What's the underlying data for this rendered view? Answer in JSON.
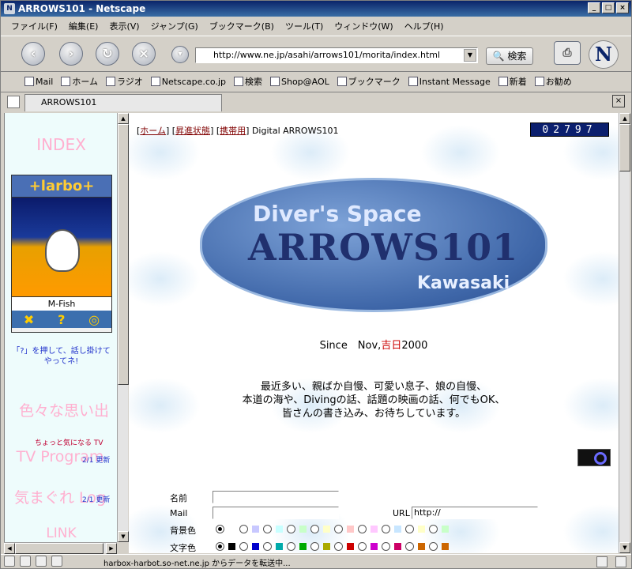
{
  "window": {
    "title": "ARROWS101 - Netscape",
    "minimize": "_",
    "maximize": "□",
    "close": "×"
  },
  "menu": [
    "ファイル(F)",
    "編集(E)",
    "表示(V)",
    "ジャンプ(G)",
    "ブックマーク(B)",
    "ツール(T)",
    "ウィンドウ(W)",
    "ヘルプ(H)"
  ],
  "nav": {
    "back": "‹",
    "forward": "›",
    "reload": "↻",
    "stop": "×",
    "url": "http://www.ne.jp/asahi/arrows101/morita/index.html",
    "search_label": "検索",
    "logo_letter": "N"
  },
  "bookmarks": [
    "Mail",
    "ホーム",
    "ラジオ",
    "Netscape.co.jp",
    "検索",
    "Shop@AOL",
    "ブックマーク",
    "Instant Message",
    "新着",
    "お勧め"
  ],
  "tab": {
    "label": "ARROWS101",
    "close": "×"
  },
  "left": {
    "index_title": "INDEX",
    "harbot_brand": "+larbo+",
    "harbot_name": "M-Fish",
    "harbot_icons": [
      "✖",
      "?",
      "◎"
    ],
    "hint": "「?」を押して、話し掛けて やってネ!",
    "item1": "色々な思い出",
    "item2_small": "ちょっと気になる TV",
    "item2_big": "TV Program",
    "item2_update": "2/1 更新",
    "item3_big": "気まぐれ Log",
    "item3_update": "2/1 更新",
    "link": "LINK"
  },
  "main": {
    "links": [
      "ホーム",
      "昇進状態",
      "携帯用"
    ],
    "site_label": "Digital ARROWS101",
    "counter": "02797",
    "logo": {
      "line1": "Diver's Space",
      "line2": "ARROWS101",
      "line3": "Kawasaki"
    },
    "since_prefix": "Since　Nov,",
    "since_red": "吉日",
    "since_year": "2000",
    "message": [
      "最近多い、親ばか自慢、可愛い息子、娘の自慢、",
      "本道の海や、Divingの話、話題の映画の話、何でもOK、",
      "皆さんの書き込み、お待ちしています。"
    ],
    "form": {
      "name_label": "名前",
      "mail_label": "Mail",
      "url_label": "URL",
      "url_value": "http://",
      "bg_label": "背景色",
      "text_label": "文字色"
    }
  },
  "colors": {
    "bg_swatches": [
      "#ffffff",
      "#c8c8ff",
      "#c8ffff",
      "#c8ffc8",
      "#ffffc8",
      "#ffc8c8",
      "#ffc8ff",
      "#c8e6ff",
      "#ffffc8",
      "#c8ffc8"
    ],
    "text_swatches": [
      "#000000",
      "#0000cc",
      "#00aaaa",
      "#00aa00",
      "#aaaa00",
      "#cc0000",
      "#cc00cc",
      "#cc0066",
      "#cc6600",
      "#cc6600"
    ]
  },
  "status": {
    "text": "harbox-harbot.so-net.ne.jp からデータを転送中..."
  }
}
